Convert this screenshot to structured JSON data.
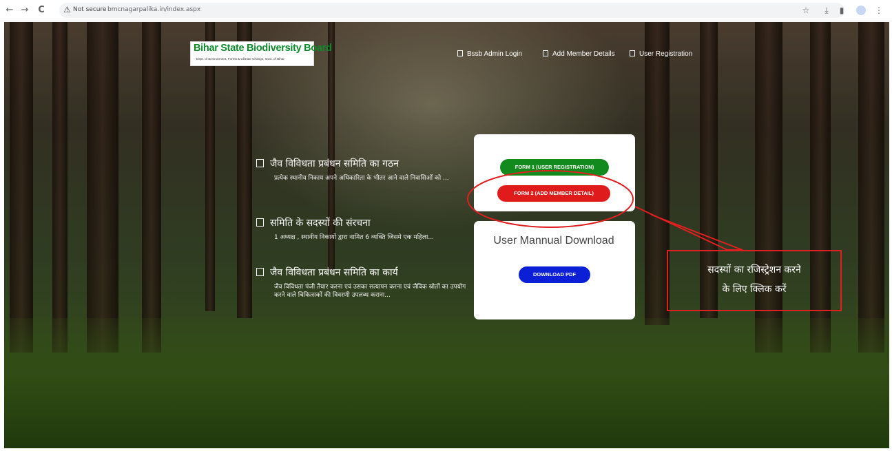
{
  "browser": {
    "back_icon": "←",
    "forward_icon": "→",
    "reload_icon": "C",
    "security_icon": "⚠",
    "security_label": "Not secure",
    "url": "bmcnagarpalika.in/index.aspx",
    "star_icon": "☆",
    "download_icon": "⤓",
    "sidepanel_icon": "▮",
    "menu_icon": "⋮"
  },
  "logo": {
    "title": "Bihar State Biodiversity Board",
    "subtitle": "Dept. of Environment, Forest & Climate Change, Govt. of Bihar"
  },
  "nav": {
    "items": [
      {
        "label": "Bssb Admin Login"
      },
      {
        "label": "Add Member Details"
      },
      {
        "label": "User Registration"
      }
    ]
  },
  "info": {
    "items": [
      {
        "heading": "जैव विविधता प्रबंधन समिति का गठन",
        "desc": "प्रत्येक स्थानीय निकाय अपने अधिकारिता के भीतर आने वाले निवासिओं को ..."
      },
      {
        "heading": "समिति के सदस्यों की संरचना",
        "desc": "1 अध्यक्ष , स्थानीय निकायों द्वारा नामित 6 व्यक्ति जिसमे एक महिला..."
      },
      {
        "heading": "जैव विविधता प्रबंधन समिति का कार्य",
        "desc": "जैव विविधता पंजी तैयार करना एवं उसका सत्यापन करना एवं जैविक स्रोतों का उपयोग करने वाले चिकित्सकों की विवरणी उपलब्ध कराना..."
      }
    ]
  },
  "forms_card": {
    "form1_label": "FORM 1 (USER REGISTRATION)",
    "form2_label": "FORM 2 (ADD MEMBER DETAIL)"
  },
  "manual_card": {
    "title": "User Mannual Download",
    "download_label": "DOWNLOAD PDF"
  },
  "annotation": {
    "line1": "सदस्यों का  रजिस्ट्रेशन करने",
    "line2": "के लिए क्लिक करें"
  },
  "colors": {
    "form1": "#138a1e",
    "form2": "#e01b1b",
    "download": "#0b1fd6",
    "logo_green": "#0d8a2a",
    "annotation_red": "#e02020"
  }
}
